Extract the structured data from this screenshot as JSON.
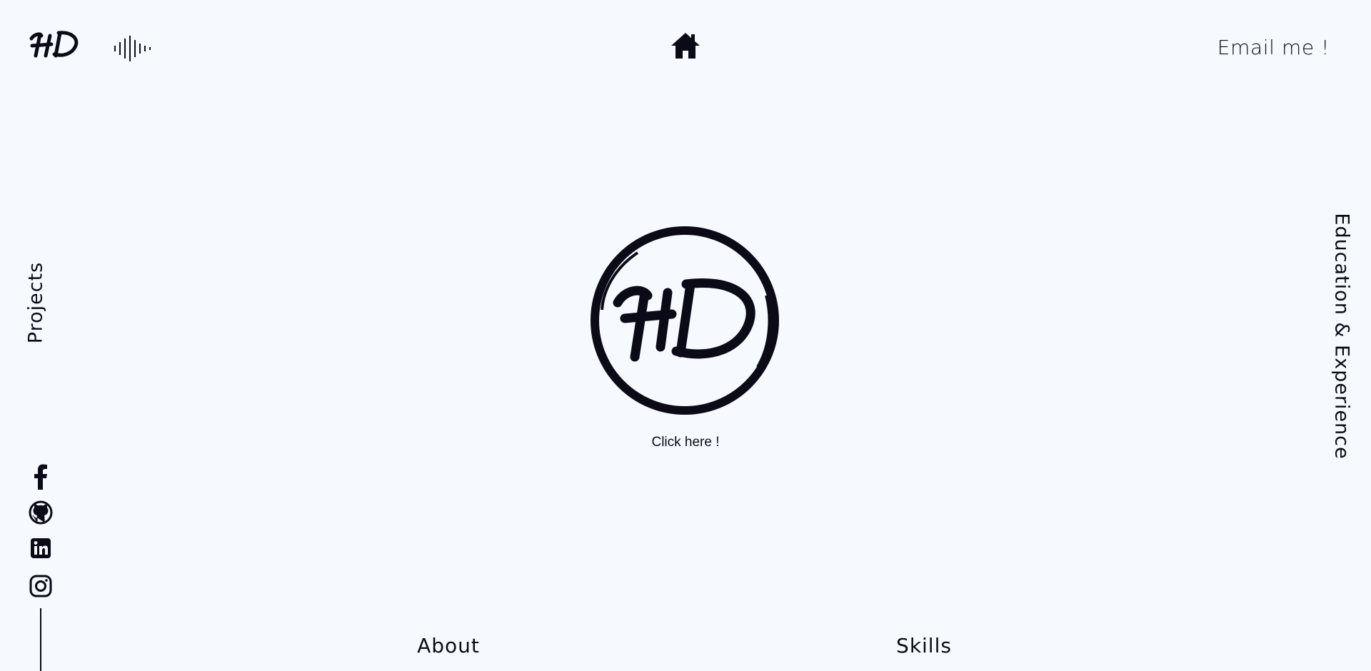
{
  "header": {
    "logo": {
      "text": "HD",
      "icon": "hd-monogram-logo"
    },
    "sound_toggle": {
      "icon": "soundwave-icon"
    },
    "home": {
      "icon": "home-icon"
    },
    "email_link": "Email me !"
  },
  "side_nav": {
    "left_link": "Projects",
    "right_link": "Education & Experience"
  },
  "center": {
    "logo": {
      "text": "HD",
      "icon": "hd-circle-logo"
    },
    "cta": "Click here !"
  },
  "socials": [
    {
      "icon": "facebook-icon"
    },
    {
      "icon": "github-icon"
    },
    {
      "icon": "linkedin-icon"
    },
    {
      "icon": "instagram-icon"
    }
  ],
  "footer_nav": {
    "about": "About",
    "skills": "Skills"
  },
  "colors": {
    "background": "#f6fafe",
    "foreground": "#0b0b18"
  }
}
